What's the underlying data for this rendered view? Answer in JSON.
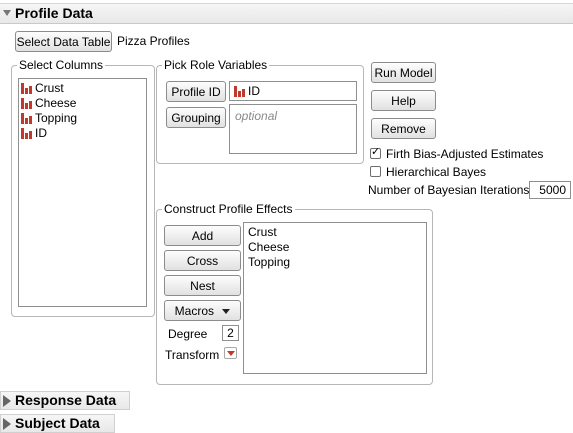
{
  "profile_section": {
    "title": "Profile Data"
  },
  "data_table": {
    "button_label": "Select Data Table",
    "table_name": "Pizza Profiles"
  },
  "select_columns": {
    "label": "Select Columns",
    "items": [
      {
        "label": "Crust",
        "icon": "nominal-column-icon"
      },
      {
        "label": "Cheese",
        "icon": "nominal-column-icon"
      },
      {
        "label": "Topping",
        "icon": "nominal-column-icon"
      },
      {
        "label": "ID",
        "icon": "nominal-column-icon"
      }
    ]
  },
  "pick_role": {
    "label": "Pick Role Variables",
    "profile_id_button": "Profile ID",
    "profile_id_value": "ID",
    "grouping_button": "Grouping",
    "grouping_placeholder": "optional"
  },
  "actions": {
    "run_model": "Run Model",
    "help": "Help",
    "remove": "Remove"
  },
  "options": {
    "firth": {
      "label": "Firth Bias-Adjusted Estimates",
      "checked": true
    },
    "hier_bayes": {
      "label": "Hierarchical Bayes",
      "checked": false
    },
    "bayes_iter_label": "Number of Bayesian Iterations",
    "bayes_iter_value": "5000"
  },
  "construct": {
    "label": "Construct Profile Effects",
    "add": "Add",
    "cross": "Cross",
    "nest": "Nest",
    "macros": "Macros",
    "degree_label": "Degree",
    "degree_value": "2",
    "transform_label": "Transform",
    "effects": [
      "Crust",
      "Cheese",
      "Topping"
    ]
  },
  "response_section": {
    "title": "Response Data"
  },
  "subject_section": {
    "title": "Subject Data"
  },
  "colors": {
    "accent_red": "#c0392b",
    "border": "#b6b6b6"
  }
}
